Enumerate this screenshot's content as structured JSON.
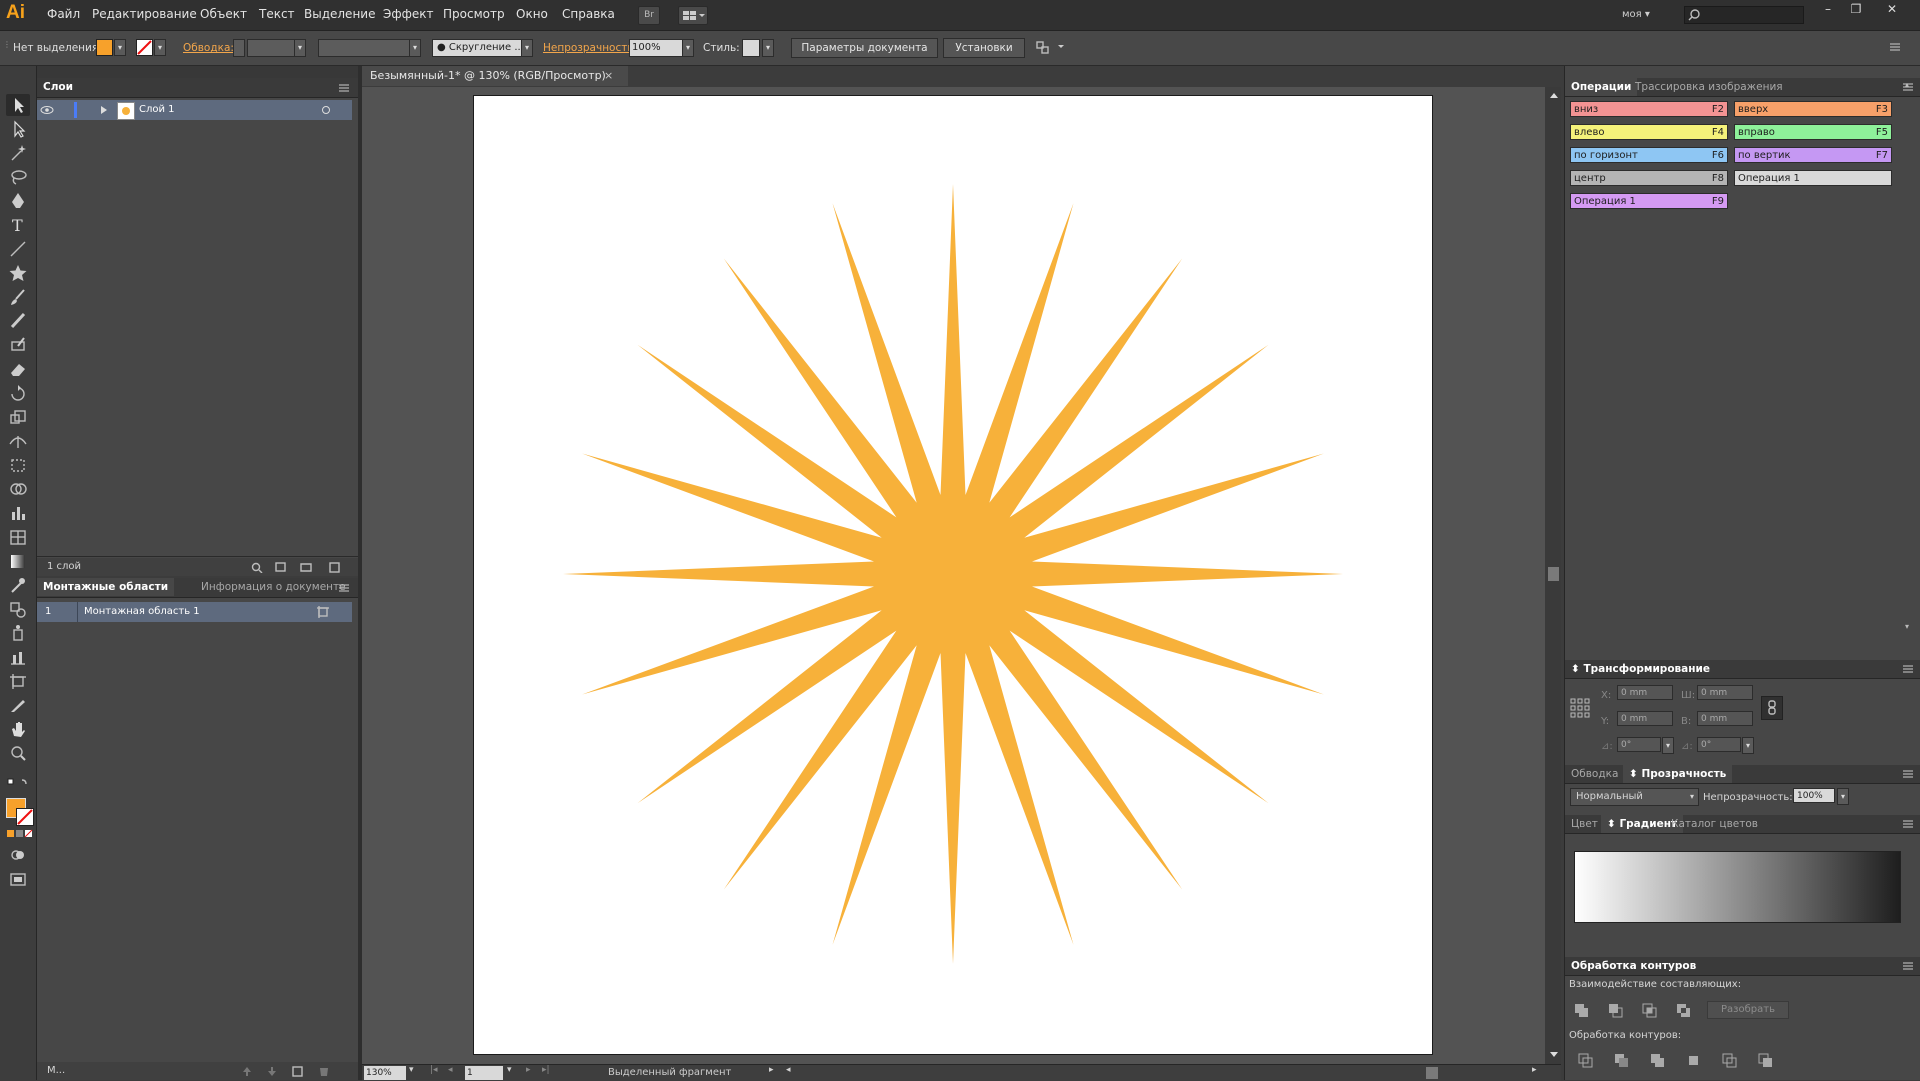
{
  "app": {
    "logo": "Ai"
  },
  "menu": [
    "Файл",
    "Редактирование",
    "Объект",
    "Текст",
    "Выделение",
    "Эффект",
    "Просмотр",
    "Окно",
    "Справка"
  ],
  "menubar": {
    "bridge_label": "Br",
    "workspace": "моя",
    "search_placeholder": ""
  },
  "window_buttons": [
    "–",
    "❐",
    "✕"
  ],
  "control": {
    "selection": "Нет выделения",
    "stroke_label": "Обводка:",
    "brush_label": "Скругление ...",
    "opacity_label": "Непрозрачность:",
    "opacity_value": "100%",
    "style_label": "Стиль:",
    "doc_settings": "Параметры документа",
    "preferences": "Установки",
    "fill_color": "#f7a12b"
  },
  "layers_panel": {
    "title": "Слои",
    "layer_name": "Слой 1",
    "count": "1 слой"
  },
  "artboards_panel": {
    "tabs": [
      "Монтажные области",
      "Информация о документе"
    ],
    "row_num": "1",
    "row_name": "Монтажная область 1",
    "footer": "М..."
  },
  "document": {
    "tab": "Безымянный-1* @ 130% (RGB/Просмотр)",
    "star_color": "#f7b13a",
    "zoom": "130%",
    "page": "1",
    "status": "Выделенный фрагмент"
  },
  "actions_panel": {
    "tabs": [
      "Операции",
      "Трассировка изображения"
    ],
    "buttons": [
      {
        "label": "вниз",
        "key": "F2",
        "color": "#f39393"
      },
      {
        "label": "вверх",
        "key": "F3",
        "color": "#f7a069"
      },
      {
        "label": "влево",
        "key": "F4",
        "color": "#f5f27a"
      },
      {
        "label": "вправо",
        "key": "F5",
        "color": "#8ef19a"
      },
      {
        "label": "по горизонт",
        "key": "F6",
        "color": "#8ec6f3"
      },
      {
        "label": "по вертик",
        "key": "F7",
        "color": "#c598f3"
      },
      {
        "label": "центр",
        "key": "F8",
        "color": "#b4b4b4"
      },
      {
        "label": "Операция 1",
        "key": "",
        "color": "#d9d9d9"
      },
      {
        "label": "Операция 1",
        "key": "F9",
        "color": "#d59af3"
      }
    ]
  },
  "transform_panel": {
    "title": "Трансформирование",
    "x_label": "X:",
    "x_value": "0 mm",
    "w_label": "Ш:",
    "w_value": "0 mm",
    "y_label": "Y:",
    "y_value": "0 mm",
    "h_label": "В:",
    "h_value": "0 mm",
    "angle_value": "0°",
    "shear_value": "0°"
  },
  "transparency_panel": {
    "tabs": [
      "Обводка",
      "Прозрачность"
    ],
    "mode": "Нормальный",
    "opacity_label": "Непрозрачность:",
    "opacity_value": "100%"
  },
  "gradient_panel": {
    "tabs": [
      "Цвет",
      "Градиент",
      "Каталог цветов"
    ]
  },
  "pathfinder_panel": {
    "title": "Обработка контуров",
    "shape_modes_label": "Взаимодействие составляющих:",
    "expand_label": "Разобрать",
    "pathfinders_label": "Обработка контуров:"
  }
}
